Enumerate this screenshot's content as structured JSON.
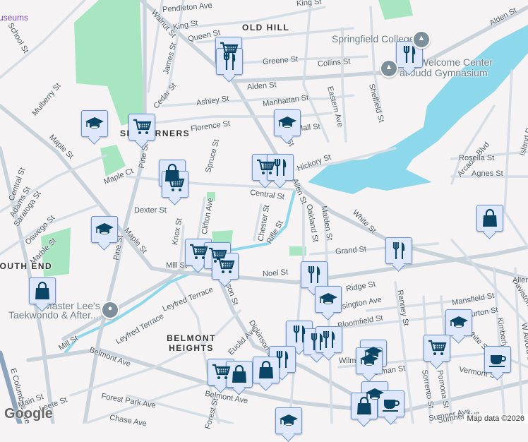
{
  "map": {
    "colors": {
      "land": "#f5f3f4",
      "road": "#d5dde5",
      "major_road": "#c9d3dc",
      "water": "#8ed8ec",
      "park": "#a8e6c2",
      "marker_fill": "#dfe8fb",
      "marker_border": "#6a94d8",
      "icon": "#0b4566"
    },
    "street_labels": [
      "Pendleton Ave",
      "King St",
      "Queen St",
      "King St",
      "Walnut St",
      "James St",
      "Cedar St",
      "Greene St",
      "Collins St",
      "Alden St",
      "Alden St",
      "Eastern Ave",
      "Sheffield St",
      "Manhattan St",
      "Ashley St",
      "Mulberry St",
      "School St",
      "Florence St",
      "Spruce St",
      "Hickory St",
      "Walnut St",
      "Maple St",
      "Pine St",
      "Maple Ct",
      "Central St",
      "Allen St",
      "Arcadia Blvd",
      "Rosella St",
      "Agnes St",
      "Island Pond Rd",
      "Dexter St",
      "Clifton Ave",
      "Chester St",
      "Rifle St",
      "Oakland St",
      "Malden St",
      "White St",
      "Knox St",
      "Maple St",
      "Pine St",
      "Oswego St",
      "Marble St",
      "Central St",
      "Adams St",
      "Saratoga St",
      "Mill St",
      "Noel St",
      "Grand St",
      "Dickinson St",
      "Leyfred Terrace",
      "Leyfred Terrace",
      "Mill St",
      "Belmont Ave",
      "Euclid Ave",
      "E Columbus Ave",
      "Main St",
      "Leete St",
      "Forest Park Ave",
      "Chase Ave",
      "Belmont Ave",
      "Forest St",
      "Kensington Ave",
      "Bloomfield St",
      "Ranney St",
      "Sorrento St",
      "Pomona St",
      "Sumner Ave",
      "Vermont St",
      "Mansfield St",
      "Burton St",
      "Kimberly",
      "W Alvord St",
      "Daviston",
      "Allen St",
      "White St",
      "Ridge St",
      "Alderman St",
      "Wilmont St",
      "Dickinson St",
      "Sumner Ave",
      "Mall St"
    ],
    "neighborhoods": [
      "OLD HILL",
      "SIX CORNERS",
      "SOUTH END",
      "BELMONT HEIGHTS"
    ],
    "places": [
      "Springfield College",
      "Welcome Center",
      "at Judd Gymnasium",
      "Master Lee's",
      "Taekwondo & After...",
      "Museums"
    ],
    "markers": [
      "cart",
      "fork",
      "grad",
      "cart",
      "bag",
      "cart",
      "cart",
      "fork",
      "grad",
      "fork",
      "bag",
      "grad",
      "cart",
      "cart",
      "cart",
      "bag",
      "fork",
      "fork",
      "grad",
      "fork",
      "fork",
      "fork",
      "fork",
      "grad",
      "cart",
      "coffee",
      "grad",
      "grad",
      "cart",
      "bag",
      "bag",
      "grad",
      "bag",
      "coffee",
      "grad"
    ],
    "google_logo": "Google",
    "attribution": "Map data ©2026"
  }
}
